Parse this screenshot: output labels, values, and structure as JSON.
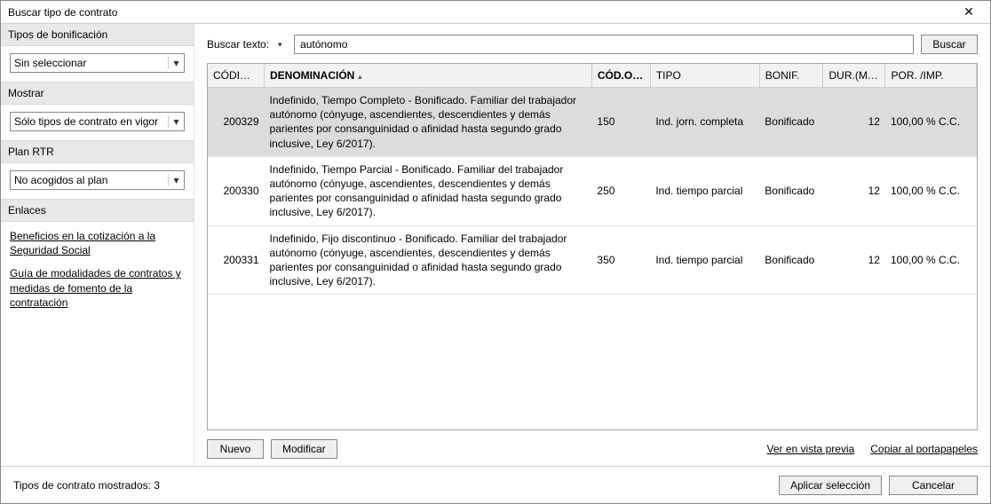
{
  "window": {
    "title": "Buscar tipo de contrato"
  },
  "sidebar": {
    "tipos_bonificacion": {
      "header": "Tipos de bonificación",
      "value": "Sin seleccionar"
    },
    "mostrar": {
      "header": "Mostrar",
      "value": "Sólo tipos de contrato en vigor"
    },
    "plan_rtr": {
      "header": "Plan RTR",
      "value": "No acogidos al plan"
    },
    "enlaces": {
      "header": "Enlaces",
      "link1": "Beneficios en la cotización a la Seguridad Social",
      "link2": "Guía de modalidades de contratos y medidas de fomento de la contratación"
    }
  },
  "search": {
    "label": "Buscar texto:",
    "value": "autónomo",
    "button": "Buscar"
  },
  "grid": {
    "cols": {
      "codigo": "CÓDI…",
      "denominacion": "DENOMINACIÓN",
      "codo": "CÓD.O…",
      "tipo": "TIPO",
      "bonif": "BONIF.",
      "dur": "DUR.(M…",
      "porimp": "POR. /IMP."
    },
    "rows": [
      {
        "codigo": "200329",
        "denom": "Indefinido, Tiempo Completo - Bonificado. Familiar del trabajador autónomo (cónyuge, ascendientes, descendientes y demás parientes por consanguinidad o afinidad hasta segundo grado inclusive, Ley 6/2017).",
        "codo": "150",
        "tipo": "Ind. jorn. completa",
        "bonif": "Bonificado",
        "dur": "12",
        "porimp": "100,00 % C.C.",
        "selected": true
      },
      {
        "codigo": "200330",
        "denom": "Indefinido, Tiempo Parcial - Bonificado. Familiar del trabajador autónomo (cónyuge, ascendientes, descendientes y demás parientes por consanguinidad o afinidad hasta segundo grado inclusive, Ley 6/2017).",
        "codo": "250",
        "tipo": "Ind. tiempo parcial",
        "bonif": "Bonificado",
        "dur": "12",
        "porimp": "100,00 % C.C.",
        "selected": false
      },
      {
        "codigo": "200331",
        "denom": "Indefinido, Fijo discontinuo - Bonificado. Familiar del trabajador autónomo (cónyuge, ascendientes, descendientes y demás parientes por consanguinidad o afinidad hasta segundo grado inclusive, Ley 6/2017).",
        "codo": "350",
        "tipo": "Ind. tiempo parcial",
        "bonif": "Bonificado",
        "dur": "12",
        "porimp": "100,00 % C.C.",
        "selected": false
      }
    ]
  },
  "actions": {
    "nuevo": "Nuevo",
    "modificar": "Modificar",
    "vista_previa": "Ver en vista previa",
    "copiar": "Copiar al portapapeles"
  },
  "footer": {
    "status_prefix": "Tipos de contrato mostrados:  ",
    "count": "3",
    "aplicar": "Aplicar selección",
    "cancelar": "Cancelar"
  }
}
